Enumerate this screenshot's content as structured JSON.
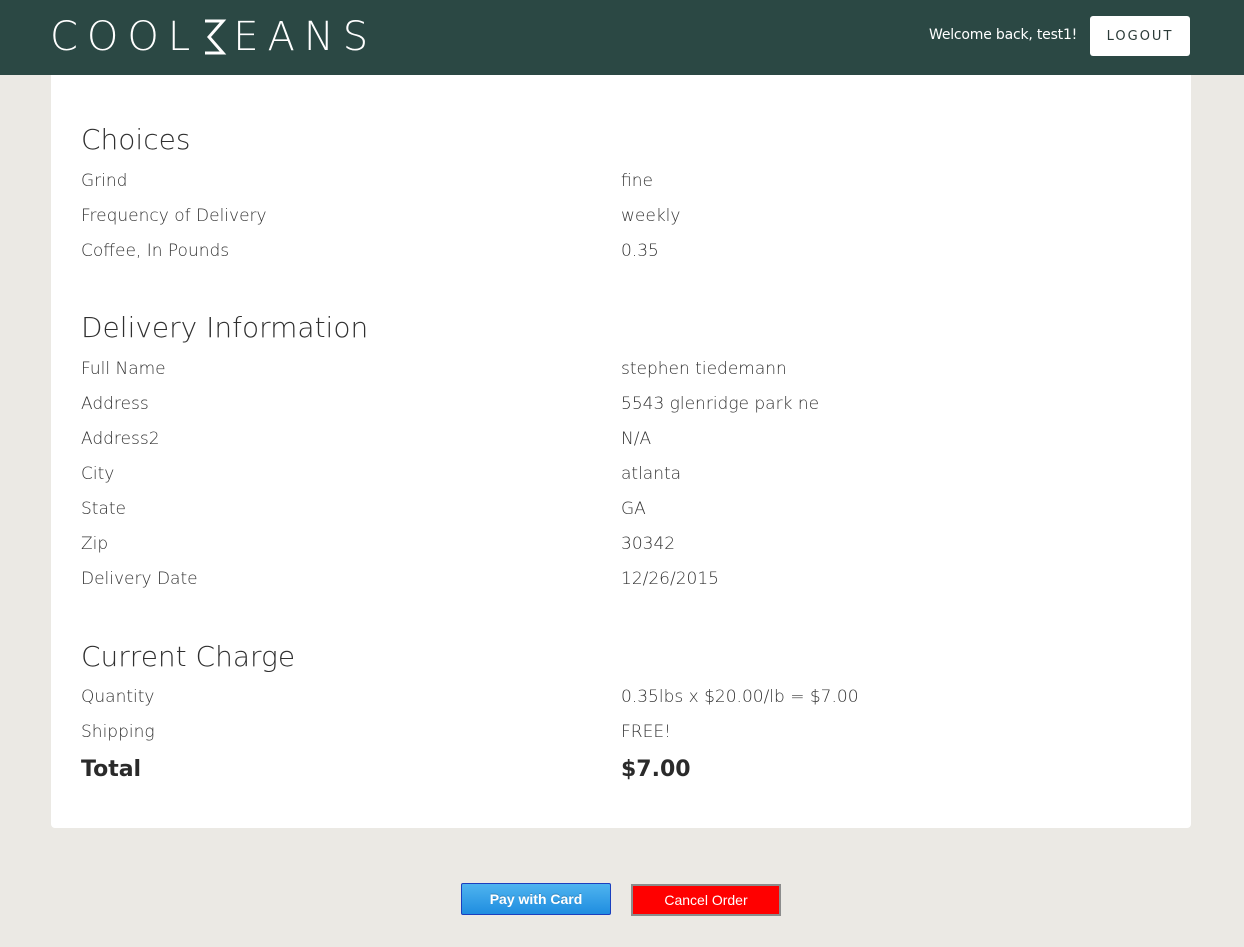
{
  "header": {
    "logo_text": "COOLBEANS",
    "welcome": "Welcome back, test1!",
    "logout_label": "LOGOUT"
  },
  "choices": {
    "title": "Choices",
    "rows": [
      {
        "label": "Grind",
        "value": "fine"
      },
      {
        "label": "Frequency of Delivery",
        "value": "weekly"
      },
      {
        "label": "Coffee, In Pounds",
        "value": "0.35"
      }
    ]
  },
  "delivery": {
    "title": "Delivery Information",
    "rows": [
      {
        "label": "Full Name",
        "value": "stephen tiedemann"
      },
      {
        "label": "Address",
        "value": "5543 glenridge park ne"
      },
      {
        "label": "Address2",
        "value": "N/A"
      },
      {
        "label": "City",
        "value": "atlanta"
      },
      {
        "label": "State",
        "value": "GA"
      },
      {
        "label": "Zip",
        "value": "30342"
      },
      {
        "label": "Delivery Date",
        "value": "12/26/2015"
      }
    ]
  },
  "charge": {
    "title": "Current Charge",
    "rows": [
      {
        "label": "Quantity",
        "value": "0.35lbs x $20.00/lb = $7.00"
      },
      {
        "label": "Shipping",
        "value": "FREE!"
      }
    ],
    "total_label": "Total",
    "total_value": "$7.00"
  },
  "actions": {
    "pay_label": "Pay with Card",
    "cancel_label": "Cancel Order"
  },
  "colors": {
    "header_bg": "#2b4844",
    "page_bg": "#ebe9e4",
    "cancel_bg": "#ff0000",
    "pay_bg": "#1f8de0"
  }
}
